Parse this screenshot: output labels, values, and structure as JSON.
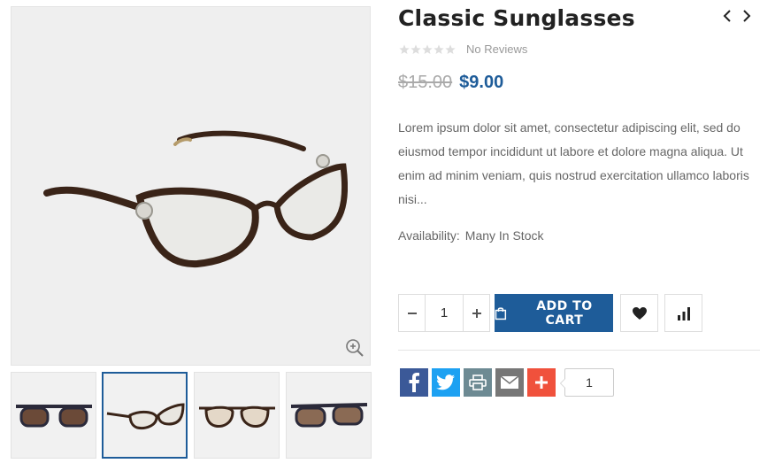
{
  "product": {
    "title": "Classic Sunglasses",
    "rating": {
      "stars": 0,
      "max": 5,
      "reviews_label": "No Reviews"
    },
    "old_price": "$15.00",
    "new_price": "$9.00",
    "description": "Lorem ipsum dolor sit amet, consectetur adipiscing elit, sed do eiusmod tempor incididunt ut labore et dolore magna aliqua. Ut enim ad minim veniam, quis nostrud exercitation ullamco laboris nisi...",
    "availability_label": "Availability:",
    "availability_value": "Many In Stock"
  },
  "cart": {
    "quantity": "1",
    "add_to_cart_label": "ADD TO CART"
  },
  "share": {
    "count": "1"
  },
  "gallery": {
    "active_thumbnail": 2,
    "thumbnail_count": 4
  },
  "icons": {
    "nav": [
      "chevron-left-icon",
      "chevron-right-icon"
    ],
    "actions": [
      "heart-icon",
      "bar-chart-icon"
    ],
    "share": [
      "facebook-icon",
      "twitter-icon",
      "print-icon",
      "email-icon",
      "plus-icon"
    ]
  },
  "colors": {
    "accent": "#1e5c99",
    "facebook": "#3b5998",
    "twitter": "#1da1f2",
    "print": "#6d8a93",
    "email": "#777777",
    "plus": "#f0513c",
    "frame": "#3a2418"
  }
}
